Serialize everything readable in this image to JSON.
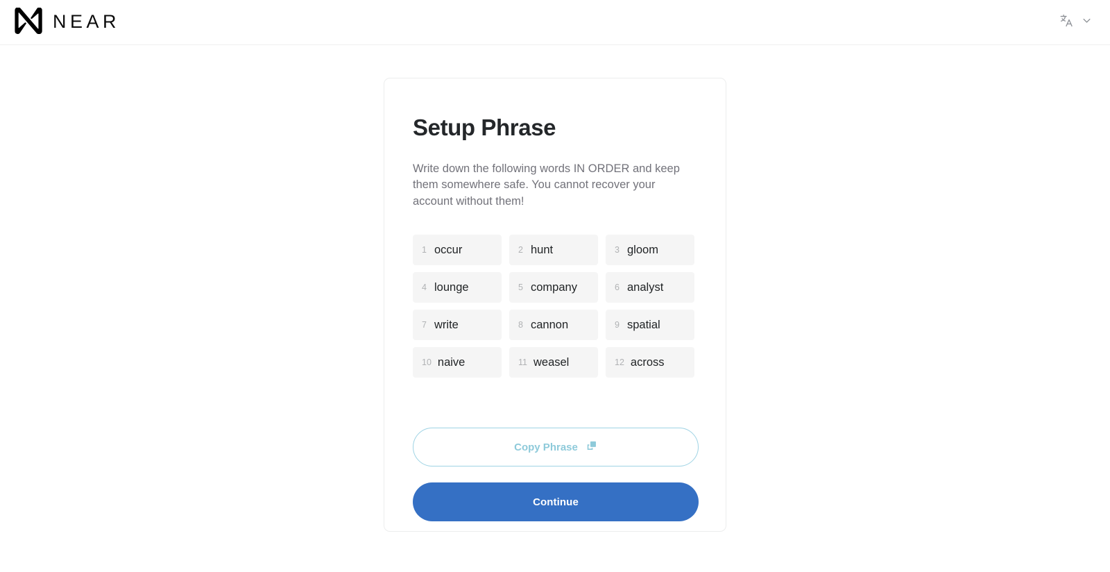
{
  "header": {
    "brand_name": "NEAR",
    "brand_mark_icon": "near-logo-icon",
    "language_icon": "translate-icon",
    "chevron_icon": "chevron-down-icon"
  },
  "card": {
    "title": "Setup Phrase",
    "description": "Write down the following words IN ORDER and keep them somewhere safe. You cannot recover your account without them!",
    "seed_words": [
      {
        "index": "1",
        "word": "occur"
      },
      {
        "index": "2",
        "word": "hunt"
      },
      {
        "index": "3",
        "word": "gloom"
      },
      {
        "index": "4",
        "word": "lounge"
      },
      {
        "index": "5",
        "word": "company"
      },
      {
        "index": "6",
        "word": "analyst"
      },
      {
        "index": "7",
        "word": "write"
      },
      {
        "index": "8",
        "word": "cannon"
      },
      {
        "index": "9",
        "word": "spatial"
      },
      {
        "index": "10",
        "word": "naive"
      },
      {
        "index": "11",
        "word": "weasel"
      },
      {
        "index": "12",
        "word": "across"
      }
    ],
    "copy_button_label": "Copy Phrase",
    "copy_button_icon": "copy-icon",
    "continue_button_label": "Continue"
  },
  "colors": {
    "page_background": "#ffffff",
    "card_border": "#eceded",
    "chip_background": "#f5f5f5",
    "title_text": "#24272a",
    "body_text": "#72727a",
    "copy_accent": "#8ecada",
    "continue_background": "#3570c4",
    "continue_text": "#ffffff"
  }
}
